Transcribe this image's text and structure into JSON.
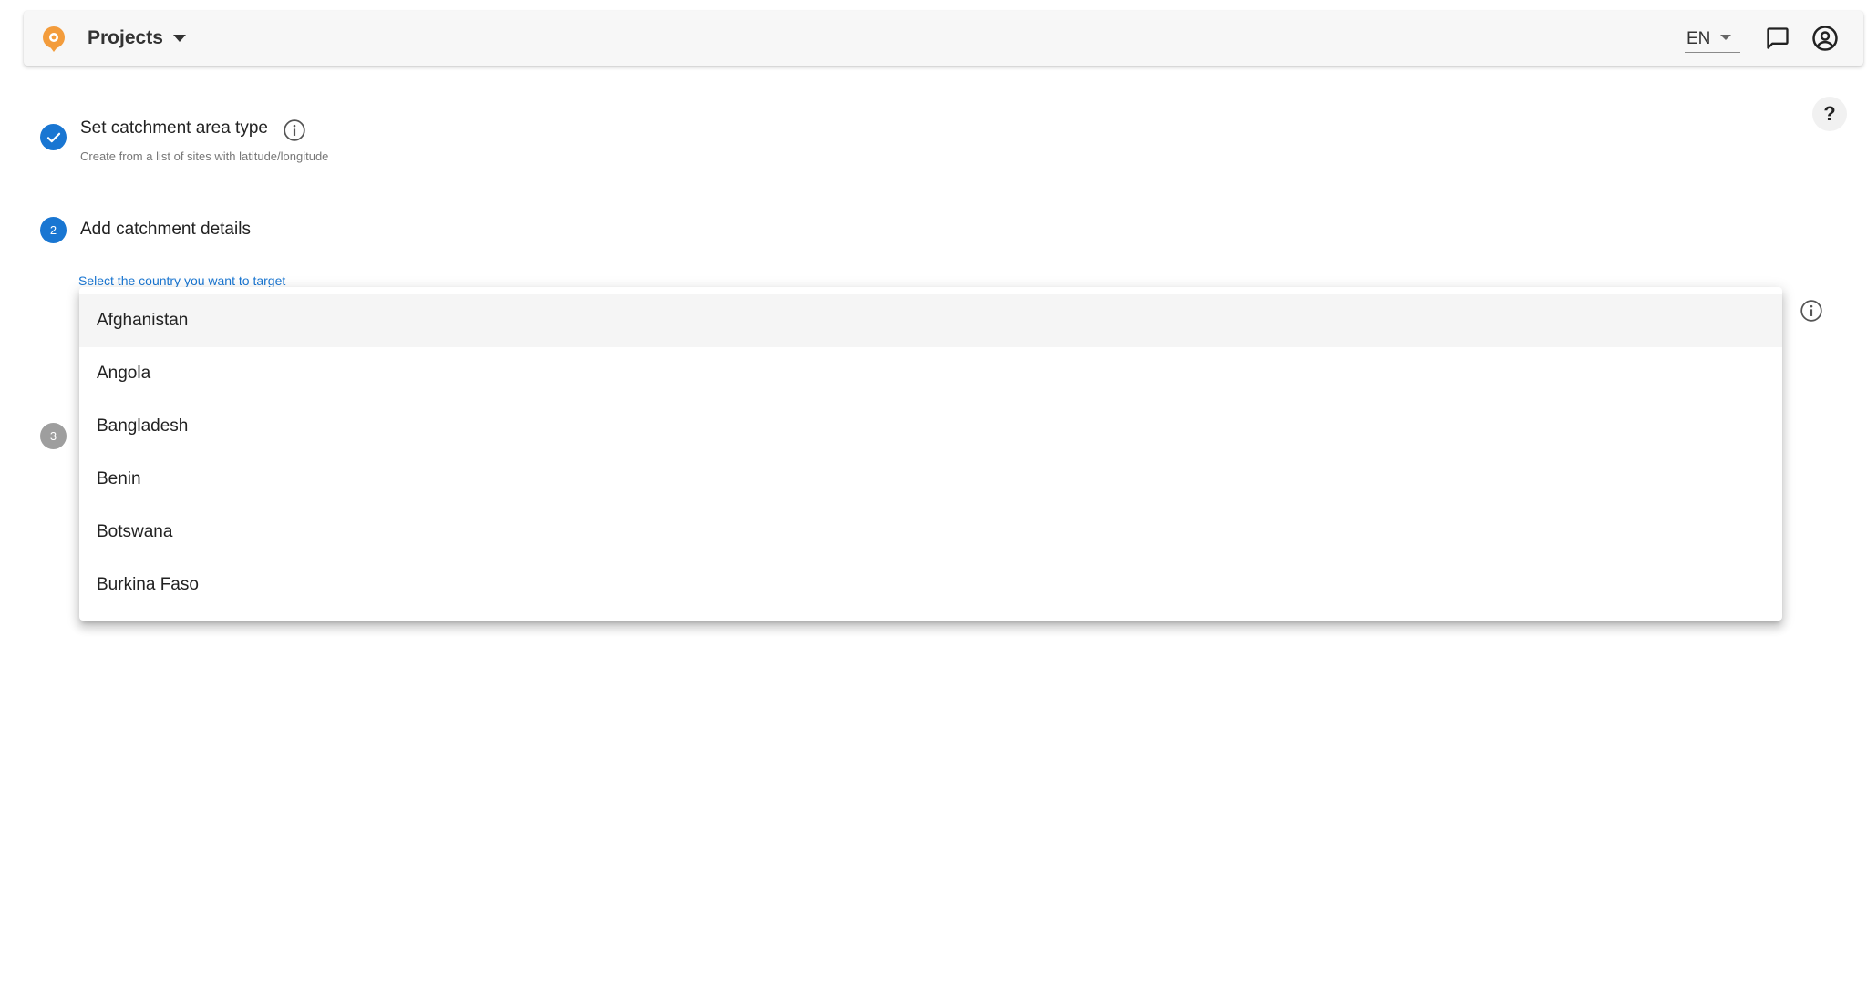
{
  "header": {
    "projects_label": "Projects",
    "language": "EN",
    "logo_icon": "location-pin-logo",
    "chat_icon": "chat-bubble-icon",
    "account_icon": "account-circle-icon"
  },
  "help": {
    "label": "?"
  },
  "steps": [
    {
      "number": "1",
      "state": "completed",
      "title": "Set catchment area type",
      "subtitle": "Create from a list of sites with latitude/longitude"
    },
    {
      "number": "2",
      "state": "active",
      "title": "Add catchment details"
    },
    {
      "number": "3",
      "state": "pending"
    }
  ],
  "country_field": {
    "label": "Select the country you want to target",
    "options": [
      "Afghanistan",
      "Angola",
      "Bangladesh",
      "Benin",
      "Botswana",
      "Burkina Faso"
    ],
    "highlighted": "Afghanistan"
  },
  "colors": {
    "primary": "#1976d2",
    "pending": "#9e9e9e",
    "logo_orange": "#f39c3c"
  }
}
